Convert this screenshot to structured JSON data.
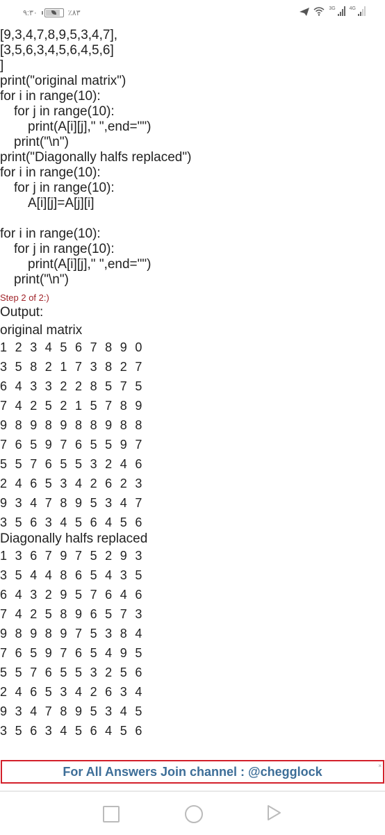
{
  "status_bar": {
    "time": "٩:٣٠",
    "battery_percent": "٪٨٣",
    "battery_level": 0.83,
    "network_1": "3G",
    "network_2": "4G",
    "icons": [
      "telegram-icon",
      "wifi-icon",
      "signal-icon",
      "signal-icon"
    ]
  },
  "code": {
    "lines_top": [
      {
        "indent": 0,
        "text": "[9,3,4,7,8,9,5,3,4,7],"
      },
      {
        "indent": 0,
        "text": "[3,5,6,3,4,5,6,4,5,6]"
      },
      {
        "indent": 0,
        "text": "]"
      },
      {
        "indent": 0,
        "text": "print(\"original matrix\")"
      },
      {
        "indent": 0,
        "text": "for i in range(10):"
      },
      {
        "indent": 1,
        "text": "for j in range(10):"
      },
      {
        "indent": 2,
        "text": "print(A[i][j],\" \",end=\"\")"
      },
      {
        "indent": 1,
        "text": "print(\"\\n\")"
      },
      {
        "indent": 0,
        "text": "print(\"Diagonally halfs replaced\")"
      },
      {
        "indent": 0,
        "text": "for i in range(10):"
      },
      {
        "indent": 1,
        "text": "for j in range(10):"
      },
      {
        "indent": 2,
        "text": "A[i][j]=A[j][i]"
      },
      {
        "indent": 0,
        "text": ""
      },
      {
        "indent": 0,
        "text": "for i in range(10):"
      },
      {
        "indent": 1,
        "text": "for j in range(10):"
      },
      {
        "indent": 2,
        "text": "print(A[i][j],\" \",end=\"\")"
      },
      {
        "indent": 1,
        "text": "print(\"\\n\")"
      }
    ]
  },
  "step_label": "Step 2 of 2:)",
  "output": {
    "label": "Output:",
    "original_title": "original matrix",
    "original_matrix": [
      [
        1,
        2,
        3,
        4,
        5,
        6,
        7,
        8,
        9,
        0
      ],
      [
        3,
        5,
        8,
        2,
        1,
        7,
        3,
        8,
        2,
        7
      ],
      [
        6,
        4,
        3,
        3,
        2,
        2,
        8,
        5,
        7,
        5
      ],
      [
        7,
        4,
        2,
        5,
        2,
        1,
        5,
        7,
        8,
        9
      ],
      [
        9,
        8,
        9,
        8,
        9,
        8,
        8,
        9,
        8,
        8
      ],
      [
        7,
        6,
        5,
        9,
        7,
        6,
        5,
        5,
        9,
        7
      ],
      [
        5,
        5,
        7,
        6,
        5,
        5,
        3,
        2,
        4,
        6
      ],
      [
        2,
        4,
        6,
        5,
        3,
        4,
        2,
        6,
        2,
        3
      ],
      [
        9,
        3,
        4,
        7,
        8,
        9,
        5,
        3,
        4,
        7
      ],
      [
        3,
        5,
        6,
        3,
        4,
        5,
        6,
        4,
        5,
        6
      ]
    ],
    "replaced_title": "Diagonally halfs replaced",
    "replaced_matrix": [
      [
        1,
        3,
        6,
        7,
        9,
        7,
        5,
        2,
        9,
        3
      ],
      [
        3,
        5,
        4,
        4,
        8,
        6,
        5,
        4,
        3,
        5
      ],
      [
        6,
        4,
        3,
        2,
        9,
        5,
        7,
        6,
        4,
        6
      ],
      [
        7,
        4,
        2,
        5,
        8,
        9,
        6,
        5,
        7,
        3
      ],
      [
        9,
        8,
        9,
        8,
        9,
        7,
        5,
        3,
        8,
        4
      ],
      [
        7,
        6,
        5,
        9,
        7,
        6,
        5,
        4,
        9,
        5
      ],
      [
        5,
        5,
        7,
        6,
        5,
        5,
        3,
        2,
        5,
        6
      ],
      [
        2,
        4,
        6,
        5,
        3,
        4,
        2,
        6,
        3,
        4
      ],
      [
        9,
        3,
        4,
        7,
        8,
        9,
        5,
        3,
        4,
        5
      ],
      [
        3,
        5,
        6,
        3,
        4,
        5,
        6,
        4,
        5,
        6
      ]
    ]
  },
  "banner": {
    "text": "For All Answers Join channel : @chegglock",
    "close": "×",
    "border_color": "#d3202a",
    "text_color": "#3d6e98"
  },
  "nav_bar": {
    "buttons": [
      "recents",
      "home",
      "back"
    ]
  }
}
